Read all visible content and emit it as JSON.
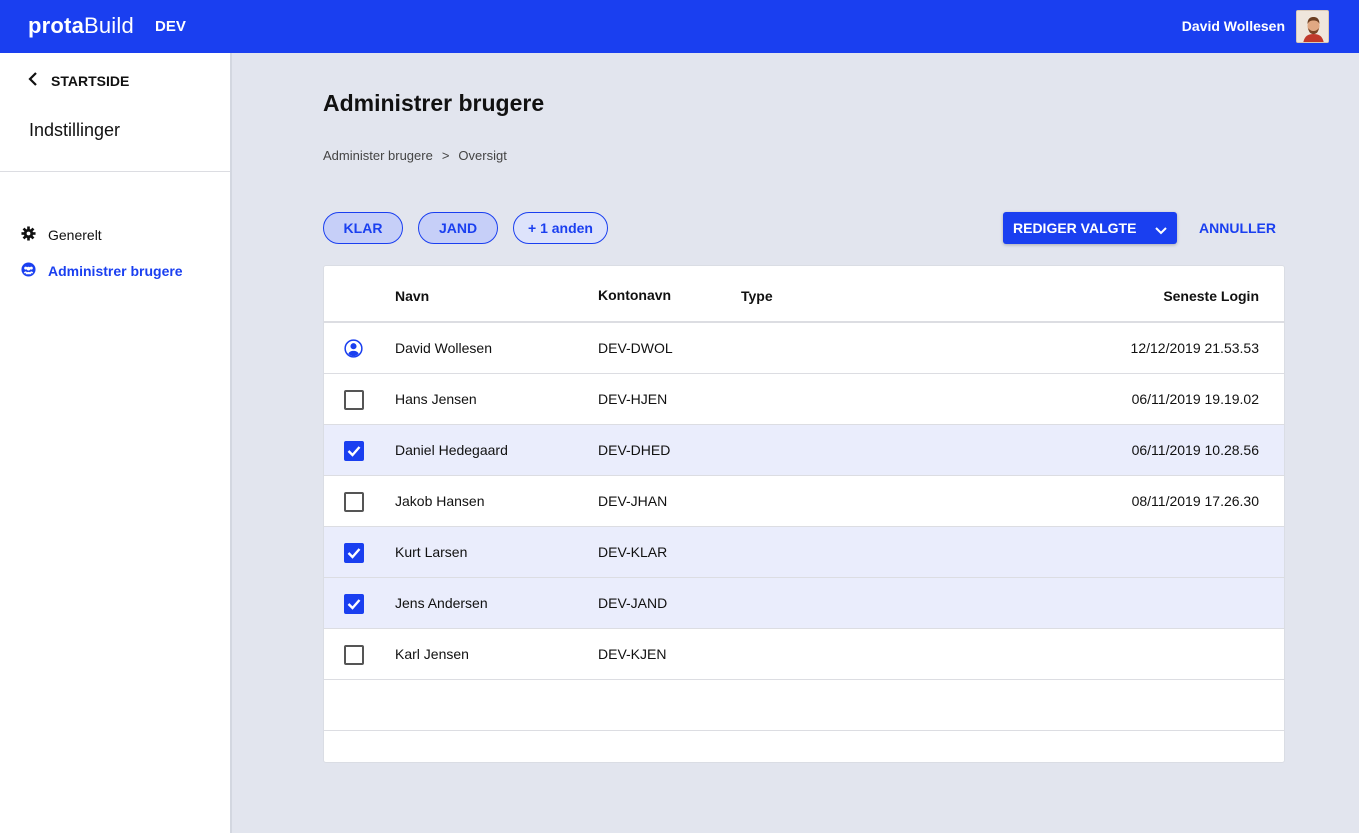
{
  "topbar": {
    "logo_bold": "prota",
    "logo_light": "Build",
    "env": "DEV",
    "user_name": "David Wollesen"
  },
  "sidebar": {
    "back_label": "STARTSIDE",
    "title": "Indstillinger",
    "items": [
      {
        "label": "Generelt",
        "icon": "gear-icon",
        "active": false
      },
      {
        "label": "Administrer brugere",
        "icon": "users-icon",
        "active": true
      }
    ]
  },
  "main": {
    "title": "Administrer brugere",
    "breadcrumb": [
      "Administer brugere",
      ">",
      "Oversigt"
    ],
    "chips": [
      "KLAR",
      "JAND",
      "+ 1 anden"
    ],
    "edit_button": "REDIGER VALGTE",
    "cancel_button": "ANNULLER"
  },
  "table": {
    "columns": [
      "Navn",
      "Kontonavn",
      "Type",
      "Seneste Login"
    ],
    "rows": [
      {
        "name": "David Wollesen",
        "account": "DEV-DWOL",
        "type": "",
        "last_login": "12/12/2019 21.53.53",
        "state": "current-user"
      },
      {
        "name": "Hans Jensen",
        "account": "DEV-HJEN",
        "type": "",
        "last_login": "06/11/2019 19.19.02",
        "state": "unchecked"
      },
      {
        "name": "Daniel Hedegaard",
        "account": "DEV-DHED",
        "type": "",
        "last_login": "06/11/2019 10.28.56",
        "state": "checked"
      },
      {
        "name": "Jakob Hansen",
        "account": "DEV-JHAN",
        "type": "",
        "last_login": "08/11/2019 17.26.30",
        "state": "unchecked"
      },
      {
        "name": "Kurt Larsen",
        "account": "DEV-KLAR",
        "type": "",
        "last_login": "",
        "state": "checked"
      },
      {
        "name": "Jens Andersen",
        "account": "DEV-JAND",
        "type": "",
        "last_login": "",
        "state": "checked"
      },
      {
        "name": "Karl Jensen",
        "account": "DEV-KJEN",
        "type": "",
        "last_login": "",
        "state": "unchecked"
      }
    ]
  },
  "colors": {
    "accent": "#1a3ff0",
    "background": "#e2e5ee",
    "selected_row": "#eaedfc"
  }
}
